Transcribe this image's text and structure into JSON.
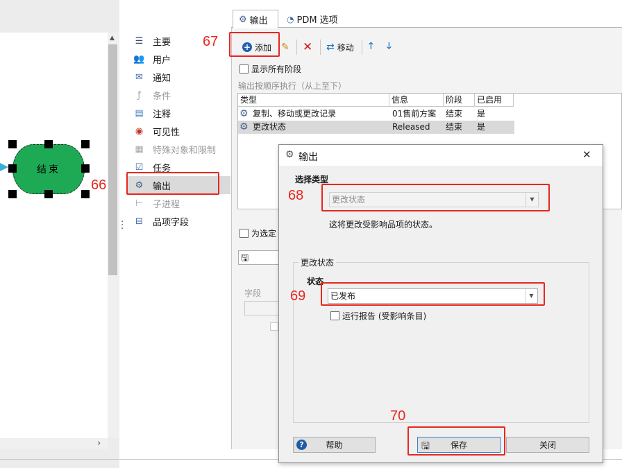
{
  "canvas": {
    "node_label": "结束"
  },
  "options": [
    {
      "label": "主要",
      "icon": "list-icon",
      "disabled": false,
      "selected": false
    },
    {
      "label": "用户",
      "icon": "users-icon",
      "disabled": false,
      "selected": false
    },
    {
      "label": "通知",
      "icon": "mail-icon",
      "disabled": false,
      "selected": false
    },
    {
      "label": "条件",
      "icon": "function-icon",
      "disabled": true,
      "selected": false
    },
    {
      "label": "注释",
      "icon": "comment-icon",
      "disabled": false,
      "selected": false
    },
    {
      "label": "可见性",
      "icon": "eye-icon",
      "disabled": false,
      "selected": false
    },
    {
      "label": "特殊对象和限制",
      "icon": "restriction-icon",
      "disabled": true,
      "selected": false
    },
    {
      "label": "任务",
      "icon": "task-icon",
      "disabled": false,
      "selected": false
    },
    {
      "label": "输出",
      "icon": "gear-icon",
      "disabled": false,
      "selected": true
    },
    {
      "label": "子进程",
      "icon": "subprocess-icon",
      "disabled": true,
      "selected": false
    },
    {
      "label": "品项字段",
      "icon": "item-fields-icon",
      "disabled": false,
      "selected": false
    }
  ],
  "tabs": {
    "output": "输出",
    "pdm": "PDM 选项"
  },
  "toolbar": {
    "add": "添加",
    "move": "移动"
  },
  "show_all_stages": "显示所有阶段",
  "order_hint": "输出按顺序执行（从上至下）",
  "table": {
    "headers": [
      "类型",
      "信息",
      "阶段",
      "已启用"
    ],
    "rows": [
      {
        "type": "复制、移动或更改记录",
        "info": "01售前方案",
        "stage": "结束",
        "enabled": "是"
      },
      {
        "type": "更改状态",
        "info": "Released",
        "stage": "结束",
        "enabled": "是"
      }
    ]
  },
  "for_selected_label": "为选定",
  "field_label": "字段",
  "dialog": {
    "title": "输出",
    "select_type_label": "选择类型",
    "type_value": "更改状态",
    "type_description": "这将更改受影响品项的状态。",
    "group_title": "更改状态",
    "state_label": "状态",
    "state_value": "已发布",
    "run_report_label": "运行报告 (受影响条目)",
    "help_button": "帮助",
    "save_button": "保存",
    "close_button": "关闭"
  },
  "annotations": {
    "n66": "66",
    "n67": "67",
    "n68": "68",
    "n69": "69",
    "n70": "70"
  },
  "colors": {
    "annotation": "#e8261e",
    "end_node_fill": "#1eaa55",
    "selection": "#dadada",
    "add_icon": "#1d62b5",
    "delete_icon": "#d11f1f",
    "arrow_icon": "#1a73c9"
  }
}
